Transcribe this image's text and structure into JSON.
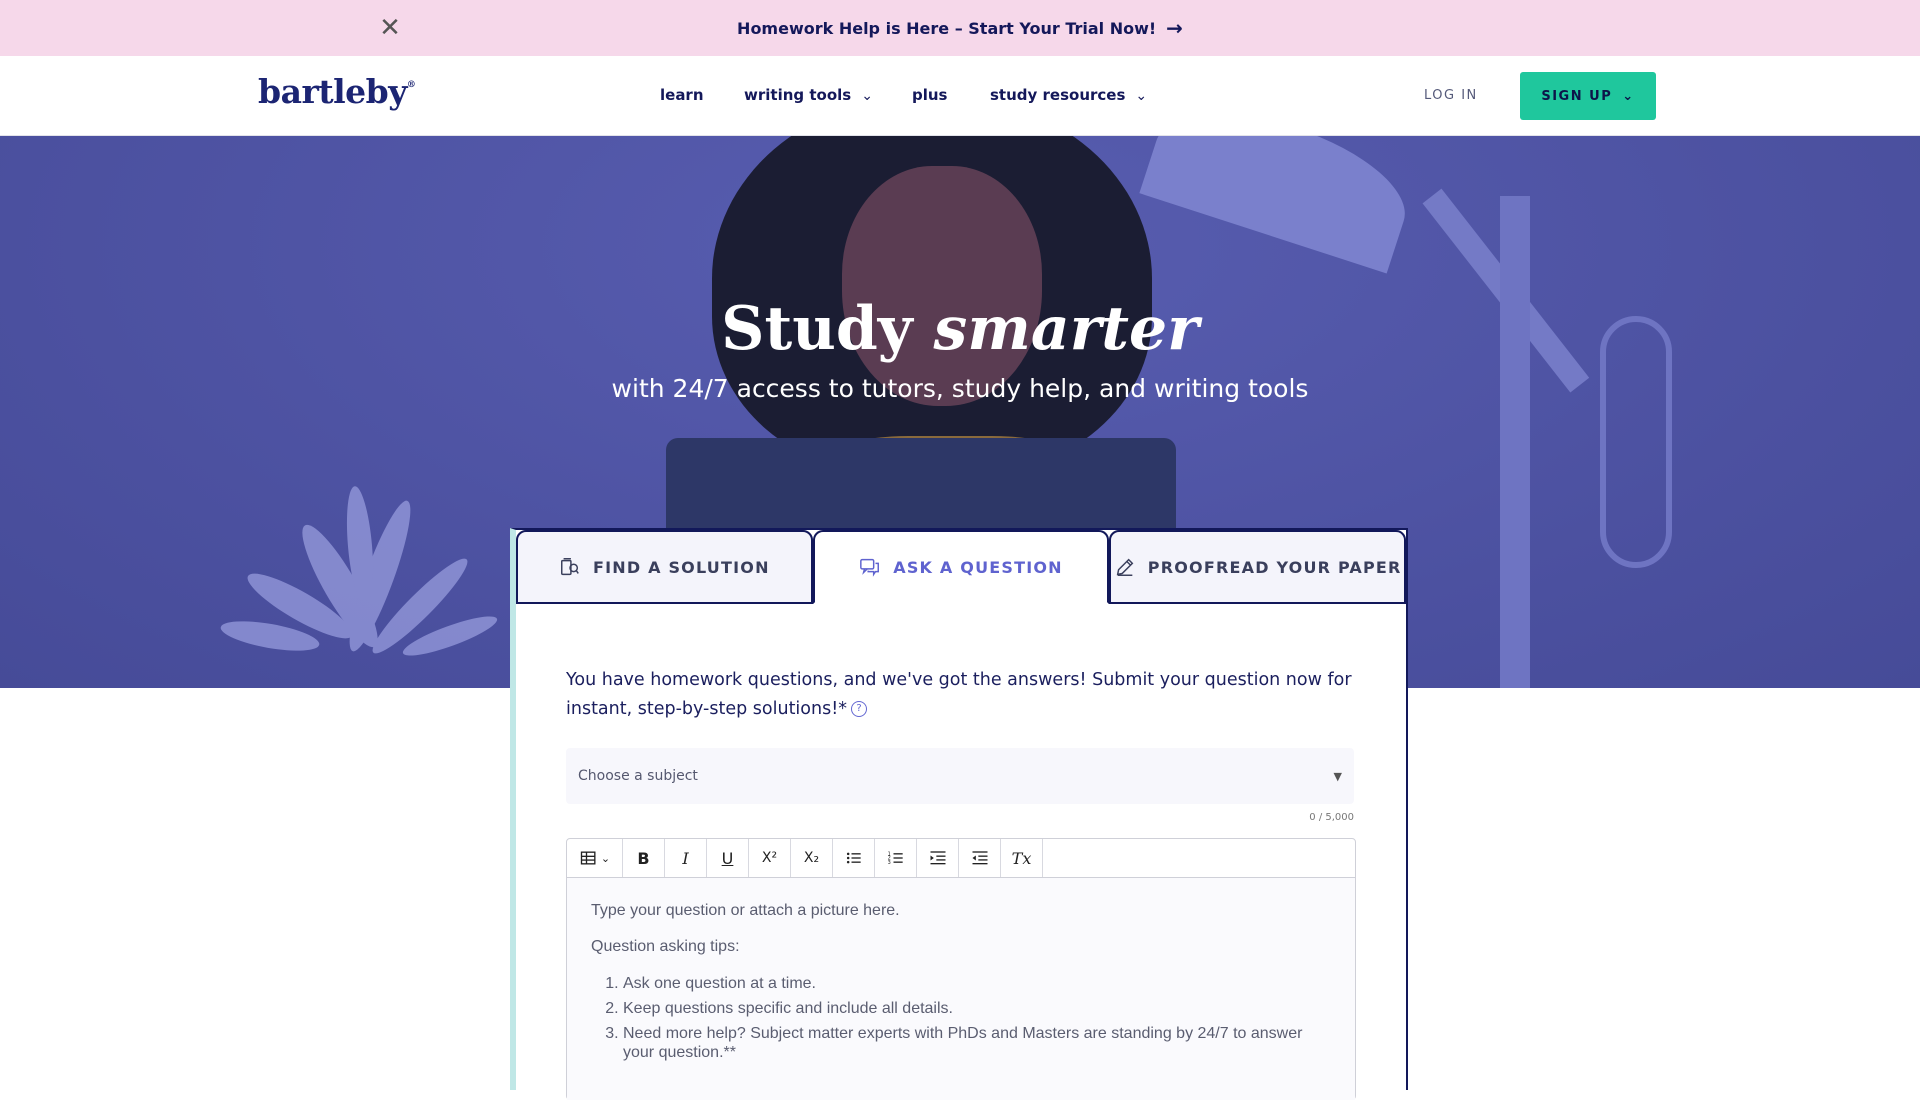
{
  "promo": {
    "text": "Homework Help is Here – Start Your Trial Now!",
    "close_icon": "close-icon",
    "arrow_icon": "arrow-right-icon"
  },
  "header": {
    "logo": "bartleby",
    "logo_mark": "®",
    "nav": [
      {
        "label": "learn",
        "dropdown": false
      },
      {
        "label": "writing tools",
        "dropdown": true
      },
      {
        "label": "plus",
        "dropdown": false
      },
      {
        "label": "study resources",
        "dropdown": true
      }
    ],
    "login": "LOG IN",
    "signup": "SIGN UP",
    "accent_color": "#1fc79d"
  },
  "hero": {
    "title_plain": "Study ",
    "title_italic": "smarter",
    "subtitle": "with 24/7 access to tutors, study help, and writing tools",
    "background_color": "#5156a8"
  },
  "tabs": [
    {
      "label": "FIND A SOLUTION",
      "icon": "book-search-icon",
      "active": false
    },
    {
      "label": "ASK A QUESTION",
      "icon": "chat-bubbles-icon",
      "active": true
    },
    {
      "label": "PROOFREAD YOUR PAPER",
      "icon": "pencil-icon",
      "active": false
    }
  ],
  "ask": {
    "intro": "You have homework questions, and we've got the answers! Submit your question now for instant, step-by-step solutions!*",
    "help_icon": "question-circle-icon",
    "subject_placeholder": "Choose a subject",
    "char_counter": "0 / 5,000",
    "editor_placeholder": "Type your question or attach a picture here.",
    "tips_title": "Question asking tips:",
    "tips": [
      "Ask one question at a time.",
      "Keep questions specific and include all details.",
      "Need more help? Subject matter experts with PhDs and Masters are standing by 24/7 to answer your question.**"
    ],
    "toolbar": [
      {
        "name": "table-icon"
      },
      {
        "name": "bold-icon",
        "glyph": "B"
      },
      {
        "name": "italic-icon",
        "glyph": "I"
      },
      {
        "name": "underline-icon",
        "glyph": "U"
      },
      {
        "name": "superscript-icon",
        "glyph": "X²"
      },
      {
        "name": "subscript-icon",
        "glyph": "X₂"
      },
      {
        "name": "bullet-list-icon"
      },
      {
        "name": "numbered-list-icon"
      },
      {
        "name": "indent-icon"
      },
      {
        "name": "outdent-icon"
      },
      {
        "name": "clear-format-icon",
        "glyph": "Tx"
      }
    ]
  }
}
